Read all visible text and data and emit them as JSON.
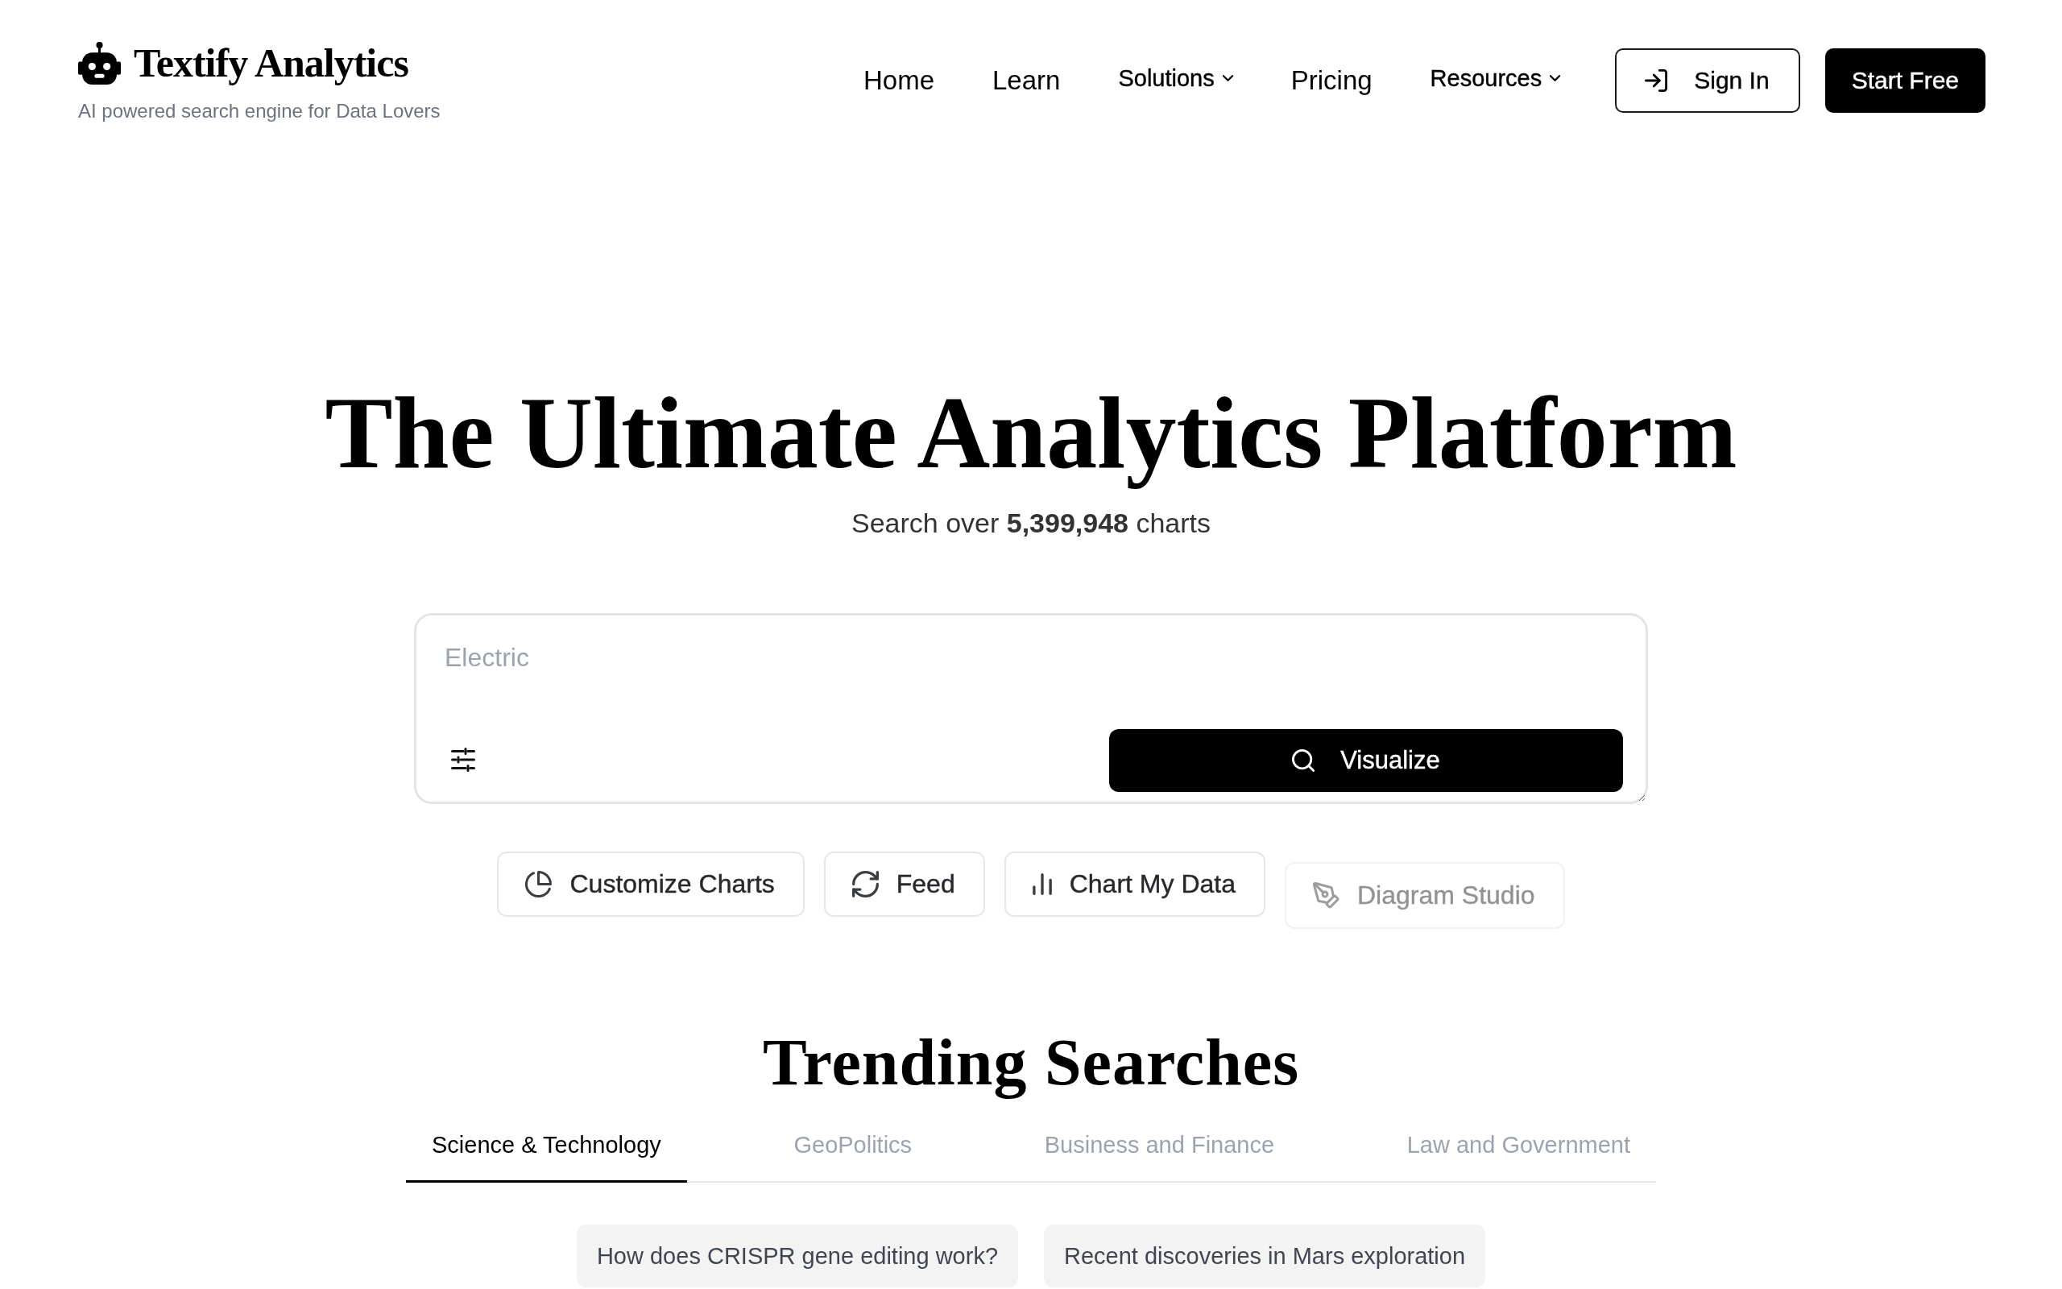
{
  "header": {
    "logo": {
      "title": "Textify Analytics",
      "tagline": "AI powered search engine for Data Lovers"
    },
    "nav": [
      {
        "label": "Home",
        "kind": "link"
      },
      {
        "label": "Learn",
        "kind": "link"
      },
      {
        "label": "Solutions",
        "kind": "dropdown"
      },
      {
        "label": "Pricing",
        "kind": "link"
      },
      {
        "label": "Resources",
        "kind": "dropdown"
      }
    ],
    "buttons": [
      {
        "label": "Sign In",
        "kind": "outline"
      },
      {
        "label": "Start Free",
        "kind": "solid"
      }
    ]
  },
  "hero": {
    "title": "The Ultimate Analytics Platform",
    "subtitle": "Search over **5,399,948** charts"
  },
  "search": {
    "placeholder": "Electric",
    "button": "Visualize"
  },
  "actions": [
    {
      "label": "Customize Charts",
      "kind": "pie",
      "disabled": false
    },
    {
      "label": "Feed",
      "kind": "refresh",
      "disabled": false
    },
    {
      "label": "Chart My Data",
      "kind": "bars",
      "disabled": false
    },
    {
      "label": "Diagram Studio",
      "kind": "pen",
      "disabled": true
    }
  ],
  "trending": {
    "title": "Trending Searches",
    "tabs": [
      {
        "label": "Science & Technology",
        "selected": true
      },
      {
        "label": "GeoPolitics",
        "selected": false
      },
      {
        "label": "Business and Finance",
        "selected": false
      },
      {
        "label": "Law and Government",
        "selected": false
      }
    ],
    "suggestions": [
      "How does CRISPR gene editing work?",
      "Recent discoveries in Mars exploration"
    ]
  }
}
